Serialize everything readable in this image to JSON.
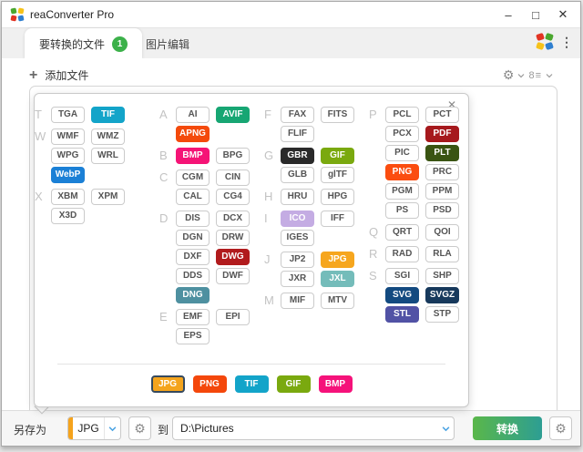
{
  "window": {
    "title": "reaConverter Pro"
  },
  "icons": {
    "minimize": "–",
    "maximize": "□",
    "close": "✕",
    "gear": "⚙",
    "plus": "+",
    "dots": "⋮",
    "list": "8≡",
    "panel_close": "✕"
  },
  "tabs": [
    {
      "label": "要转换的文件",
      "badge": "1",
      "active": true
    },
    {
      "label": "图片编辑",
      "active": false
    }
  ],
  "toolbar_top": {
    "add_files": "添加文件"
  },
  "colors": {
    "badge_green": "#3cb14a",
    "accent_orange": "#f5a31c",
    "convert_green": "#5ab74a",
    "convert_teal": "#2d9e93",
    "chevron_blue": "#4ba3e3"
  },
  "format_panel": {
    "columns": [
      {
        "groups": [
          {
            "letter": "A",
            "rows": [
              [
                {
                  "label": "AI"
                },
                {
                  "label": "AVIF",
                  "bg": "#17a673",
                  "fg": "#ffffff"
                }
              ],
              [
                {
                  "label": "APNG",
                  "bg": "#f44a0c",
                  "fg": "#ffffff"
                }
              ]
            ]
          },
          {
            "letter": "B",
            "rows": [
              [
                {
                  "label": "BMP",
                  "bg": "#f51476",
                  "fg": "#ffffff"
                },
                {
                  "label": "BPG"
                }
              ]
            ]
          },
          {
            "letter": "C",
            "rows": [
              [
                {
                  "label": "CGM"
                },
                {
                  "label": "CIN"
                }
              ],
              [
                {
                  "label": "CAL"
                },
                {
                  "label": "CG4"
                }
              ]
            ]
          },
          {
            "letter": "D",
            "rows": [
              [
                {
                  "label": "DIS"
                },
                {
                  "label": "DCX"
                }
              ],
              [
                {
                  "label": "DGN"
                },
                {
                  "label": "DRW"
                }
              ],
              [
                {
                  "label": "DXF"
                },
                {
                  "label": "DWG",
                  "bg": "#b11b1d",
                  "fg": "#ffffff"
                }
              ],
              [
                {
                  "label": "DDS"
                },
                {
                  "label": "DWF"
                }
              ],
              [
                {
                  "label": "DNG",
                  "bg": "#4e90a0",
                  "fg": "#ffffff"
                }
              ]
            ]
          },
          {
            "letter": "E",
            "rows": [
              [
                {
                  "label": "EMF"
                },
                {
                  "label": "EPI"
                }
              ],
              [
                {
                  "label": "EPS"
                }
              ]
            ]
          }
        ]
      },
      {
        "groups": [
          {
            "letter": "F",
            "rows": [
              [
                {
                  "label": "FAX"
                },
                {
                  "label": "FITS"
                }
              ],
              [
                {
                  "label": "FLIF"
                }
              ]
            ]
          },
          {
            "letter": "G",
            "rows": [
              [
                {
                  "label": "GBR",
                  "bg": "#2a2a2a",
                  "fg": "#ffffff"
                },
                {
                  "label": "GIF",
                  "bg": "#7aa90f",
                  "fg": "#ffffff"
                }
              ],
              [
                {
                  "label": "GLB"
                },
                {
                  "label": "glTF"
                }
              ]
            ]
          },
          {
            "letter": "H",
            "rows": [
              [
                {
                  "label": "HRU"
                },
                {
                  "label": "HPG"
                }
              ]
            ]
          },
          {
            "letter": "I",
            "rows": [
              [
                {
                  "label": "ICO",
                  "bg": "#c4ace3",
                  "fg": "#ffffff"
                },
                {
                  "label": "IFF"
                }
              ],
              [
                {
                  "label": "IGES"
                }
              ]
            ]
          },
          {
            "letter": "J",
            "rows": [
              [
                {
                  "label": "JP2"
                },
                {
                  "label": "JPG",
                  "bg": "#f6a61e",
                  "fg": "#ffffff"
                }
              ],
              [
                {
                  "label": "JXR"
                },
                {
                  "label": "JXL",
                  "bg": "#74bcba",
                  "fg": "#ffffff"
                }
              ]
            ]
          },
          {
            "letter": "M",
            "rows": [
              [
                {
                  "label": "MIF"
                },
                {
                  "label": "MTV"
                }
              ]
            ]
          }
        ]
      },
      {
        "groups": [
          {
            "letter": "P",
            "rows": [
              [
                {
                  "label": "PCL"
                },
                {
                  "label": "PCT"
                }
              ],
              [
                {
                  "label": "PCX"
                },
                {
                  "label": "PDF",
                  "bg": "#a6191d",
                  "fg": "#ffffff"
                }
              ],
              [
                {
                  "label": "PIC"
                },
                {
                  "label": "PLT",
                  "bg": "#3a5412",
                  "fg": "#ffffff"
                }
              ],
              [
                {
                  "label": "PNG",
                  "bg": "#fb4d10",
                  "fg": "#ffffff"
                },
                {
                  "label": "PRC"
                }
              ],
              [
                {
                  "label": "PGM"
                },
                {
                  "label": "PPM"
                }
              ],
              [
                {
                  "label": "PS"
                },
                {
                  "label": "PSD"
                }
              ]
            ]
          },
          {
            "letter": "Q",
            "rows": [
              [
                {
                  "label": "QRT"
                },
                {
                  "label": "QOI"
                }
              ]
            ]
          },
          {
            "letter": "R",
            "rows": [
              [
                {
                  "label": "RAD"
                },
                {
                  "label": "RLA"
                }
              ]
            ]
          },
          {
            "letter": "S",
            "rows": [
              [
                {
                  "label": "SGI"
                },
                {
                  "label": "SHP"
                }
              ],
              [
                {
                  "label": "SVG",
                  "bg": "#134a80",
                  "fg": "#ffffff"
                },
                {
                  "label": "SVGZ",
                  "bg": "#17395c",
                  "fg": "#ffffff"
                }
              ],
              [
                {
                  "label": "STL",
                  "bg": "#5152a5",
                  "fg": "#ffffff"
                },
                {
                  "label": "STP"
                }
              ]
            ]
          }
        ]
      },
      {
        "groups": [
          {
            "letter": "T",
            "rows": [
              [
                {
                  "label": "TGA"
                },
                {
                  "label": "TIF",
                  "bg": "#13a4c9",
                  "fg": "#ffffff"
                }
              ]
            ]
          },
          {
            "letter": "W",
            "rows": [
              [
                {
                  "label": "WMF"
                },
                {
                  "label": "WMZ"
                }
              ],
              [
                {
                  "label": "WPG"
                },
                {
                  "label": "WRL"
                }
              ],
              [
                {
                  "label": "WebP",
                  "bg": "#1b80d6",
                  "fg": "#ffffff"
                }
              ]
            ]
          },
          {
            "letter": "X",
            "rows": [
              [
                {
                  "label": "XBM"
                },
                {
                  "label": "XPM"
                }
              ],
              [
                {
                  "label": "X3D"
                }
              ]
            ]
          }
        ]
      }
    ],
    "quick_formats": [
      {
        "label": "JPG",
        "bg": "#f4a41d",
        "fg": "#ffffff",
        "selected": true
      },
      {
        "label": "PNG",
        "bg": "#f4470b",
        "fg": "#ffffff"
      },
      {
        "label": "TIF",
        "bg": "#13a4c9",
        "fg": "#ffffff"
      },
      {
        "label": "GIF",
        "bg": "#7aa90f",
        "fg": "#ffffff"
      },
      {
        "label": "BMP",
        "bg": "#f5127a",
        "fg": "#ffffff"
      }
    ]
  },
  "bottom_bar": {
    "save_as_label": "另存为",
    "format_value": "JPG",
    "to_label": "到",
    "destination": "D:\\Pictures",
    "convert_label": "转换"
  }
}
